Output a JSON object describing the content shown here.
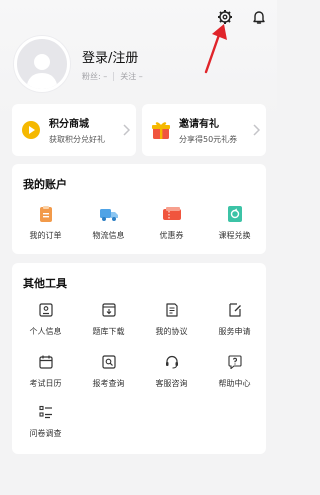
{
  "profile": {
    "login_label": "登录/注册",
    "fans_label": "粉丝: –",
    "follow_label": "关注 –"
  },
  "promos": [
    {
      "title": "积分商城",
      "subtitle": "获取积分兑好礼"
    },
    {
      "title": "邀请有礼",
      "subtitle": "分享得50元礼券"
    }
  ],
  "account": {
    "title": "我的账户",
    "items": [
      {
        "label": "我的订单",
        "icon": "clipboard-icon"
      },
      {
        "label": "物流信息",
        "icon": "truck-icon"
      },
      {
        "label": "优惠券",
        "icon": "ticket-icon"
      },
      {
        "label": "课程兑换",
        "icon": "exchange-icon"
      }
    ]
  },
  "tools": {
    "title": "其他工具",
    "items": [
      {
        "label": "个人信息",
        "icon": "id-card-icon"
      },
      {
        "label": "题库下载",
        "icon": "download-box-icon"
      },
      {
        "label": "我的协议",
        "icon": "document-icon"
      },
      {
        "label": "服务申请",
        "icon": "edit-document-icon"
      },
      {
        "label": "考试日历",
        "icon": "calendar-icon"
      },
      {
        "label": "报考查询",
        "icon": "search-document-icon"
      },
      {
        "label": "客服咨询",
        "icon": "headset-icon"
      },
      {
        "label": "帮助中心",
        "icon": "help-icon"
      },
      {
        "label": "问卷调查",
        "icon": "survey-icon"
      }
    ]
  },
  "colors": {
    "accent_orange": "#f29a4a",
    "accent_blue": "#4fa3e6",
    "accent_red": "#f0553e",
    "accent_teal": "#3cc3a6",
    "coin_yellow": "#f5b800",
    "arrow_red": "#e0242a"
  }
}
